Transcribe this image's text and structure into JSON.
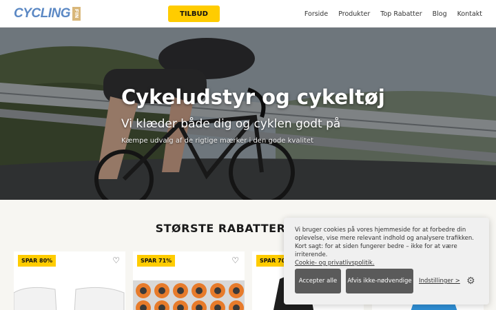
{
  "header": {
    "logo_text": "CYCLING",
    "logo_sub": "FIN",
    "cta_label": "TILBUD",
    "nav": [
      "Forside",
      "Produkter",
      "Top Rabatter",
      "Blog",
      "Kontakt"
    ]
  },
  "hero": {
    "title": "Cykeludstyr og cykeltøj",
    "subtitle": "Vi klæder både dig og cyklen godt på",
    "tagline": "Kæmpe udvalg af de rigtige mærker i den gode kvalitet"
  },
  "section": {
    "title": "STØRSTE RABATTER"
  },
  "products": [
    {
      "badge": "SPAR 80%"
    },
    {
      "badge": "SPAR 71%"
    },
    {
      "badge": "SPAR 70%"
    },
    {
      "badge": ""
    }
  ],
  "cookie": {
    "text": "Vi bruger cookies på vores hjemmeside for at forbedre din oplevelse, vise mere relevant indhold og analysere trafikken. Kort sagt: for at siden fungerer bedre – ikke for at være irriterende.",
    "policy_link": "Cookie- og privatlivspolitik.",
    "accept_label": "Accepter alle",
    "reject_label": "Afvis ikke-nødvendige",
    "settings_label": "Indstillinger >"
  },
  "colors": {
    "accent": "#ffcc00",
    "logo_blue": "#5b88c4",
    "button_dark": "#5a5a5a"
  },
  "icons": [
    "heart-icon",
    "cookie-settings-icon"
  ]
}
